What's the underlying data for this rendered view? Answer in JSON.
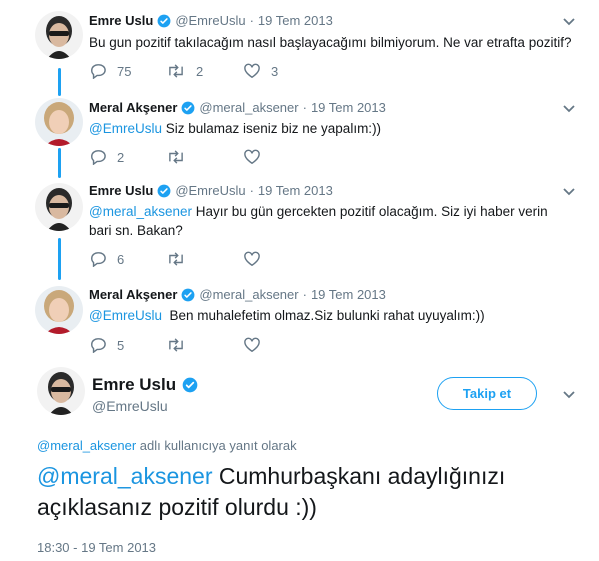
{
  "tweets": [
    {
      "name": "Emre Uslu",
      "handle": "@EmreUslu",
      "date": "19 Tem 2013",
      "text": "Bu gun pozitif takılacağım nasıl başlayacağımı bilmiyorum. Ne var etrafta pozitif?",
      "reply_count": "75",
      "retweet_count": "2",
      "like_count": "3",
      "avatar": "emre"
    },
    {
      "name": "Meral Akşener",
      "handle": "@meral_aksener",
      "date": "19 Tem 2013",
      "mention": "@EmreUslu",
      "text": " Siz bulamaz iseniz biz ne yapalım:))",
      "reply_count": "2",
      "retweet_count": "",
      "like_count": "",
      "avatar": "meral"
    },
    {
      "name": "Emre Uslu",
      "handle": "@EmreUslu",
      "date": "19 Tem 2013",
      "mention": "@meral_aksener",
      "text": " Hayır bu gün gercekten pozitif olacağım. Siz iyi haber verin bari sn. Bakan?",
      "reply_count": "6",
      "retweet_count": "",
      "like_count": "",
      "avatar": "emre"
    },
    {
      "name": "Meral Akşener",
      "handle": "@meral_aksener",
      "date": "19 Tem 2013",
      "mention": "@EmreUslu",
      "text": "  Ben muhalefetim olmaz.Siz bulunki rahat uyuyalım:))",
      "reply_count": "5",
      "retweet_count": "",
      "like_count": "",
      "avatar": "meral"
    }
  ],
  "main_tweet": {
    "name": "Emre Uslu",
    "handle": "@EmreUslu",
    "follow_label": "Takip et",
    "reply_to_mention": "@meral_aksener",
    "reply_to_suffix": " adlı kullanıcıya yanıt olarak",
    "mention": "@meral_aksener",
    "text": " Cumhurbaşkanı adaylığınızı açıklasanız pozitif olurdu :))",
    "timestamp": "18:30 - 19 Tem 2013"
  },
  "colors": {
    "accent": "#1da1f2",
    "link": "#1b95e0",
    "muted": "#657786",
    "text": "#14171a"
  },
  "icons": [
    "reply-icon",
    "retweet-icon",
    "like-icon",
    "verified-icon",
    "chevron-down-icon"
  ]
}
